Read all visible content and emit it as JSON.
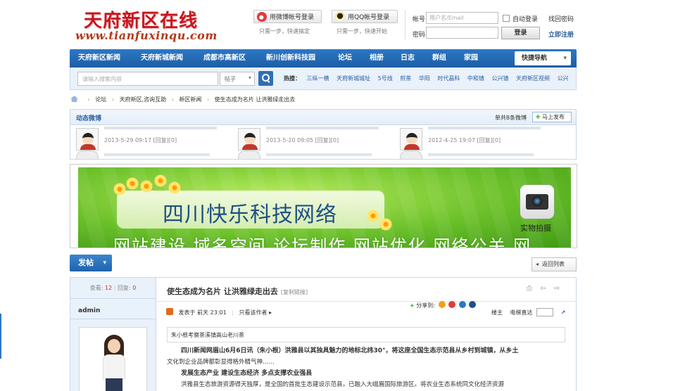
{
  "header": {
    "logo_cn": "天府新区在线",
    "logo_en": "www.tianfuxinqu.com",
    "weibo_button": "用微博帐号登录",
    "weibo_sub": "只需一步，快速搞定",
    "qq_button": "用QQ帐号登录",
    "qq_sub": "只需一步，快速开始",
    "account_label": "帐号",
    "account_placeholder": "用户名/Email",
    "auto_login": "自动登录",
    "forgot": "找回密码",
    "password_label": "密码",
    "login_button": "登录",
    "register": "立即注册"
  },
  "nav": {
    "items": [
      "天府新区新闻",
      "天府新城新闻",
      "成都市高新区",
      "新川创新科技园",
      "论坛",
      "相册",
      "日志",
      "群组",
      "家园"
    ],
    "quick": "快捷导航"
  },
  "search": {
    "placeholder": "请输入搜索内容",
    "scope": "帖子",
    "hot_label": "热搜：",
    "hot_words": [
      "三纵一横",
      "天府新城城址",
      "5号线",
      "煎茶",
      "华阳",
      "时代晶科",
      "中和镇",
      "公兴镇",
      "天府新区视频",
      "公兴"
    ]
  },
  "breadcrumb": [
    "论坛",
    "天府新区,咨询互助",
    "新区新闻",
    "使生态成为名片 让洪雅绿走出去"
  ],
  "dynamics": {
    "title": "动态微博",
    "count": "单共8条微博",
    "post_button": "马上发布",
    "entries": [
      {
        "meta": "2013-5-29 09:17 [回复][0]"
      },
      {
        "meta": "2013-5-20 09:05 [回复][0]"
      },
      {
        "meta": "2012-4-25 19:07 [回复][0]"
      }
    ]
  },
  "banner": {
    "name": "四川快乐科技网络",
    "tagline": "网站建设  域名空间  论坛制作  网站优化  网络公关  网",
    "camera_label": "实物拍摄"
  },
  "actions": {
    "post": "发帖",
    "back": "返回列表"
  },
  "thread": {
    "views_label": "查看:",
    "views": "12",
    "replies_label": "回复:",
    "replies": "0",
    "author": "admin",
    "title": "使生态成为名片 让洪雅绿走出去",
    "copy_link": "[复制链接]",
    "tools": "⎙ ⇦ ⇨",
    "posted": "发表于",
    "posted_time": "前天 23:01",
    "author_only": "只看该作者",
    "share": "分享到:",
    "floor_label": "楼主",
    "jump_label": "电梯直达",
    "tags": "朱小根考察茶溪镇高山老川茶",
    "paragraphs": [
      "四川新闻网眉山6月6日讯（朱小根）洪雅县以其独具魅力的地标北纬30°，将这座全国生态示范县从乡村到城镇，从乡土",
      "文化到企业品牌都彰显得格外精气神……",
      "发展生态产业  建设生态经济  多点支撑农业强县",
      "洪雅县生态旅游资源得天独厚，是全国的首批生态建设示范县，已融入大峨眉国际旅游区。将农业生态系统同文化经济资源"
    ]
  }
}
